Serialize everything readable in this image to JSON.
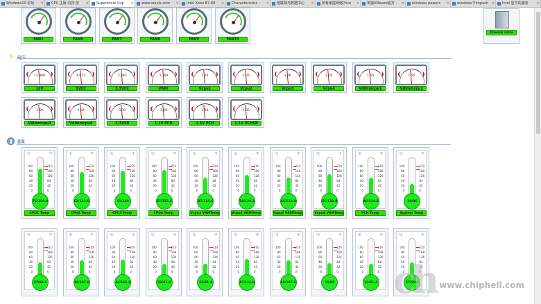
{
  "browser": {
    "tabs": [
      {
        "title": "Windows10 论坛",
        "active": false
      },
      {
        "title": "CPU 主板 内存 技",
        "active": false
      },
      {
        "title": "Supermicro Sup",
        "active": true
      },
      {
        "title": "www.oracle.com",
        "active": false
      },
      {
        "title": "Intel Xeon E7-88",
        "active": false
      },
      {
        "title": "Characteristics -",
        "active": false
      },
      {
        "title": "他联网与数据中心",
        "active": false
      },
      {
        "title": "所有家庭网络Price",
        "active": false
      },
      {
        "title": "单独VMware官方",
        "active": false
      },
      {
        "title": "windows powers",
        "active": false
      },
      {
        "title": "windows下impach",
        "active": false
      },
      {
        "title": "Intel 官方的服务",
        "active": false
      }
    ]
  },
  "fans": {
    "items": [
      {
        "label": "FAN1"
      },
      {
        "label": "FAN5"
      },
      {
        "label": "FAN7"
      },
      {
        "label": "FAN8"
      },
      {
        "label": "FAN9"
      },
      {
        "label": "FAN10"
      }
    ]
  },
  "chassis": {
    "label": "Chassis Intru"
  },
  "voltage": {
    "title": "电压",
    "items": [
      {
        "label": "12V",
        "value": "11.969"
      },
      {
        "label": "5VCC",
        "value": "4.973"
      },
      {
        "label": "3.3VCC",
        "value": "3.383"
      },
      {
        "label": "VBAT",
        "value": "3.169"
      },
      {
        "label": "Vcpu1",
        "value": "1.76"
      },
      {
        "label": "Vcpu2",
        "value": "1.76"
      },
      {
        "label": "Vcpu3",
        "value": "1.76"
      },
      {
        "label": "Vcpu4",
        "value": "1.76"
      },
      {
        "label": "Vdimmcpu1",
        "value": "1.50"
      },
      {
        "label": "Vdimmcpu2",
        "value": "1.50"
      },
      {
        "label": "Vdimmcpu3",
        "value": "1.50"
      },
      {
        "label": "Vdimmcpu4",
        "value": "1.50"
      },
      {
        "label": "3.3VSB",
        "value": "3.30"
      },
      {
        "label": "1.1V PCH",
        "value": "1.05"
      },
      {
        "label": "1.5V PCH",
        "value": "1.50"
      },
      {
        "label": "1.1V PCHSB",
        "value": "1.05"
      }
    ]
  },
  "temperature": {
    "title": "温度",
    "units": {
      "c": "°C",
      "f": "°F"
    },
    "scale_c": [
      "100",
      "80",
      "60",
      "40",
      "20",
      "0"
    ],
    "scale_f": [
      "210",
      "168",
      "126",
      "84",
      "42",
      "0"
    ],
    "row1": [
      {
        "label": "CPU1 Temp",
        "value": "71/159.8",
        "level": 0.71
      },
      {
        "label": "CPU2 Temp",
        "value": "62/143.6",
        "level": 0.62
      },
      {
        "label": "CPU3 Temp",
        "value": "65/149",
        "level": 0.65
      },
      {
        "label": "CPU4 Temp",
        "value": "67/152.6",
        "level": 0.67
      },
      {
        "label": "Vcpu1 VRMTemp",
        "value": "47/116.6",
        "level": 0.47
      },
      {
        "label": "Vcpu2 VRMTemp",
        "value": "54/129.2",
        "level": 0.54
      },
      {
        "label": "Vcpu3 VRMTemp",
        "value": "46/114.8",
        "level": 0.46
      },
      {
        "label": "Vcpu4 VRMTemp",
        "value": "56/132.8",
        "level": 0.56
      },
      {
        "label": "PCH Temp",
        "value": "46/114.8",
        "level": 0.46
      },
      {
        "label": "System Temp",
        "value": "30/86",
        "level": 0.3
      }
    ],
    "row2": [
      {
        "value": "37/98.6",
        "level": 0.37
      },
      {
        "value": "42/107.6",
        "level": 0.42
      },
      {
        "value": "44/111.2",
        "level": 0.44
      },
      {
        "value": "33/91.4",
        "level": 0.33
      },
      {
        "value": "33/91.4",
        "level": 0.33
      },
      {
        "value": "47/116.6",
        "level": 0.47
      },
      {
        "value": "42/107.6",
        "level": 0.42
      },
      {
        "value": "35/95",
        "level": 0.35
      },
      {
        "value": "33/91.4",
        "level": 0.33
      },
      {
        "value": "37/98.6",
        "level": 0.37
      }
    ]
  },
  "watermark": {
    "url": "www.chiphell.com"
  }
}
